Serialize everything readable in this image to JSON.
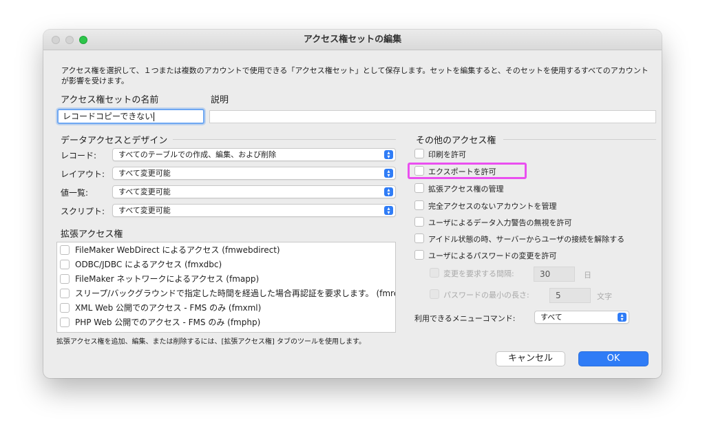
{
  "window": {
    "title": "アクセス権セットの編集"
  },
  "description": "アクセス権を選択して、１つまたは複数のアカウントで使用できる「アクセス権セット」として保存します。セットを編集すると、そのセットを使用するすべてのアカウントが影響を受けます。",
  "name_label": "アクセス権セットの名前",
  "desc_label": "説明",
  "name_value": "レコードコピーできない",
  "desc_value": "",
  "data_access": {
    "title": "データアクセスとデザイン",
    "rows": [
      {
        "label": "レコード:",
        "value": "すべてのテーブルでの作成、編集、および削除"
      },
      {
        "label": "レイアウト:",
        "value": "すべて変更可能"
      },
      {
        "label": "値一覧:",
        "value": "すべて変更可能"
      },
      {
        "label": "スクリプト:",
        "value": "すべて変更可能"
      }
    ]
  },
  "extended": {
    "title": "拡張アクセス権",
    "items": [
      "FileMaker WebDirect によるアクセス (fmwebdirect)",
      "ODBC/JDBC によるアクセス (fmxdbc)",
      "FileMaker ネットワークによるアクセス (fmapp)",
      "スリープ/バックグラウンドで指定した時間を経過した場合再認証を要求します。 (fmreaut...",
      "XML Web 公開でのアクセス - FMS のみ (fmxml)",
      "PHP Web 公開でのアクセス - FMS のみ (fmphp)"
    ],
    "footer": "拡張アクセス権を追加、編集、または削除するには、[拡張アクセス権] タブのツールを使用します。"
  },
  "other": {
    "title": "その他のアクセス権",
    "options": [
      "印刷を許可",
      "エクスポートを許可",
      "拡張アクセス権の管理",
      "完全アクセスのないアカウントを管理",
      "ユーザによるデータ入力警告の無視を許可",
      "アイドル状態の時、サーバーからユーザの接続を解除する",
      "ユーザによるパスワードの変更を許可"
    ],
    "change_interval_label": "変更を要求する間隔:",
    "change_interval_value": "30",
    "change_interval_unit": "日",
    "min_length_label": "パスワードの最小の長さ:",
    "min_length_value": "5",
    "min_length_unit": "文字",
    "menu_label": "利用できるメニューコマンド:",
    "menu_value": "すべて"
  },
  "buttons": {
    "cancel": "キャンセル",
    "ok": "OK"
  },
  "colors": {
    "accent": "#2f7cf6",
    "highlight": "#ea4ff0"
  }
}
